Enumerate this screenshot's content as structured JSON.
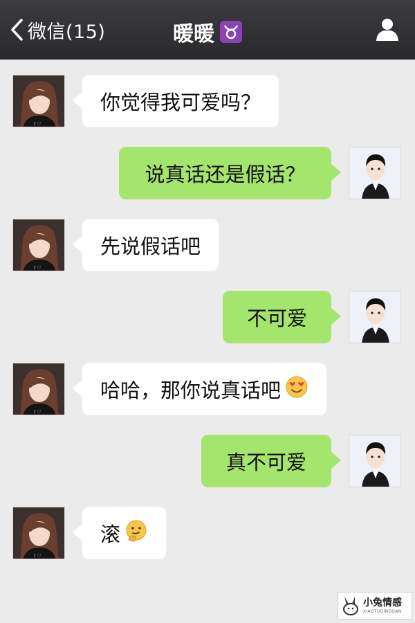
{
  "navbar": {
    "back_label": "微信(15)",
    "title": "暖暖",
    "title_icon": "taurus-icon",
    "right_icon": "profile-icon"
  },
  "messages": [
    {
      "side": "left",
      "sender": "暖暖",
      "text": "你觉得我可爱吗？"
    },
    {
      "side": "right",
      "sender": "me",
      "text": "说真话还是假话？"
    },
    {
      "side": "left",
      "sender": "暖暖",
      "text": "先说假话吧"
    },
    {
      "side": "right",
      "sender": "me",
      "text": "不可爱"
    },
    {
      "side": "left",
      "sender": "暖暖",
      "text": "哈哈，那你说真话吧",
      "emoji": "heart-eyes-emoji"
    },
    {
      "side": "right",
      "sender": "me",
      "text": "真不可爱"
    },
    {
      "side": "left",
      "sender": "暖暖",
      "text": "滚",
      "emoji": "thinking-emoji"
    }
  ],
  "watermark": {
    "title": "小兔情感",
    "subtitle": "XIAOTUQINGGAN"
  },
  "colors": {
    "navbar": "#2f2f32",
    "background": "#ebebeb",
    "bubble_me": "#a4e56e",
    "bubble_other": "#ffffff",
    "zodiac_badge": "#8b44b5"
  }
}
